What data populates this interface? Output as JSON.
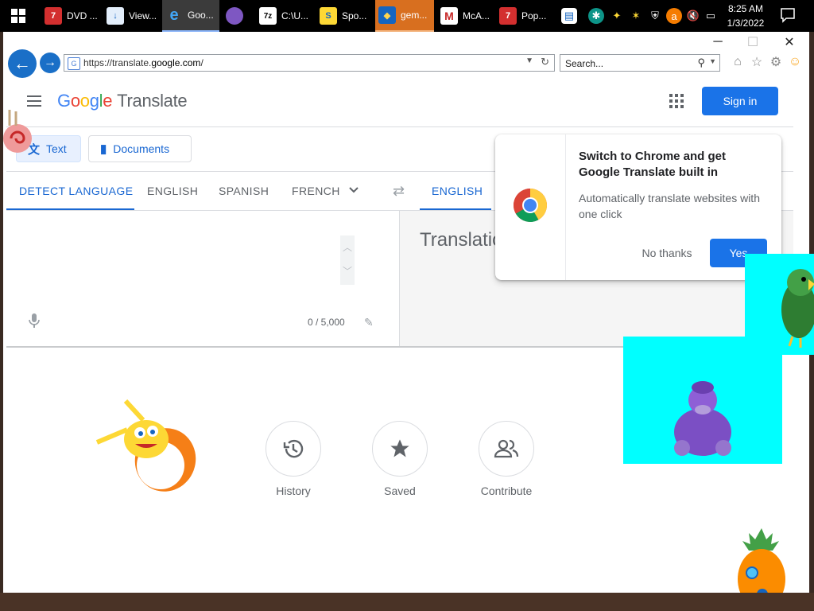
{
  "taskbar": {
    "buttons": [
      {
        "label": "DVD ...",
        "icon": "dvd-icon",
        "color": "#d32f2f"
      },
      {
        "label": "View...",
        "icon": "download-icon",
        "color": "#5b8fd6"
      },
      {
        "label": "Goo...",
        "icon": "ie-icon",
        "color": "#1e88e5"
      },
      {
        "label": "",
        "icon": "bonzi-icon",
        "color": "#7e57c2"
      },
      {
        "label": "C:\\U...",
        "icon": "7zip-icon",
        "color": "#fff"
      },
      {
        "label": "Spo...",
        "icon": "spongebob-icon",
        "color": "#fdd835"
      },
      {
        "label": "gem...",
        "icon": "shield-icon",
        "color": "#f9a825"
      },
      {
        "label": "McA...",
        "icon": "mcafee-icon",
        "color": "#c62828"
      },
      {
        "label": "Pop...",
        "icon": "popup-icon",
        "color": "#d32f2f"
      }
    ],
    "clock": {
      "time": "8:25 AM",
      "date": "1/3/2022"
    }
  },
  "browser": {
    "url_prefix": "https://translate.",
    "url_domain": "google.com",
    "url_suffix": "/",
    "search_placeholder": "Search..."
  },
  "header": {
    "logo_letters": [
      "G",
      "o",
      "o",
      "g",
      "l",
      "e"
    ],
    "product": "Translate",
    "sign_in": "Sign in"
  },
  "modes": {
    "text": "Text",
    "documents": "Documents"
  },
  "languages": {
    "source": [
      "DETECT LANGUAGE",
      "ENGLISH",
      "SPANISH",
      "FRENCH"
    ],
    "target_active": "ENGLISH"
  },
  "source": {
    "char_count": "0 / 5,000"
  },
  "target": {
    "placeholder": "Translation"
  },
  "actions": [
    {
      "label": "History",
      "icon": "history-icon"
    },
    {
      "label": "Saved",
      "icon": "star-icon"
    },
    {
      "label": "Contribute",
      "icon": "people-icon"
    }
  ],
  "popup": {
    "title": "Switch to Chrome and get Google Translate built in",
    "body": "Automatically translate websites with one click",
    "no": "No thanks",
    "yes": "Yes"
  },
  "colors": {
    "accent": "#1a73e8",
    "link": "#1967d2"
  }
}
